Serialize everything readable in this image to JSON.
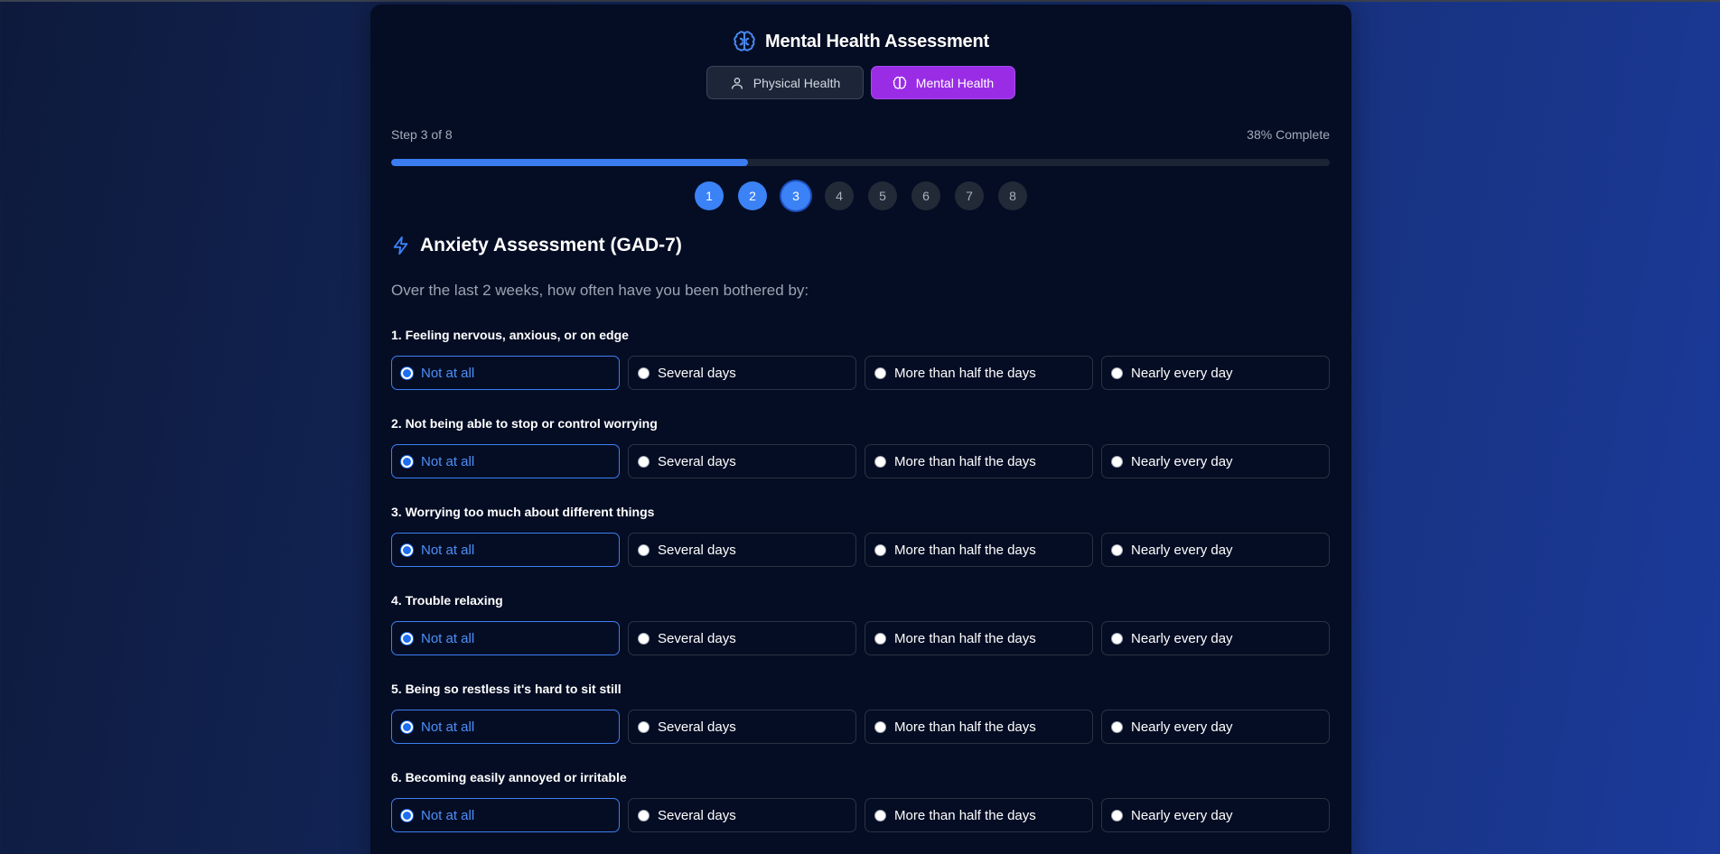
{
  "header": {
    "title": "Mental Health Assessment",
    "icon": "brain-icon",
    "accent": "#4a8bf5"
  },
  "tabs": [
    {
      "label": "Physical Health",
      "icon": "user-icon",
      "active": false
    },
    {
      "label": "Mental Health",
      "icon": "brain-icon",
      "active": true,
      "color": "#9a2ce6"
    }
  ],
  "progress": {
    "step_text": "Step 3 of 8",
    "percent_text": "38% Complete",
    "fraction": 0.38,
    "color": "#3b7cf0"
  },
  "steps": [
    {
      "label": "1",
      "state": "done"
    },
    {
      "label": "2",
      "state": "done"
    },
    {
      "label": "3",
      "state": "current"
    },
    {
      "label": "4",
      "state": "todo"
    },
    {
      "label": "5",
      "state": "todo"
    },
    {
      "label": "6",
      "state": "todo"
    },
    {
      "label": "7",
      "state": "todo"
    },
    {
      "label": "8",
      "state": "todo"
    }
  ],
  "section": {
    "title": "Anxiety Assessment (GAD-7)",
    "icon": "lightning-icon",
    "instructions": "Over the last 2 weeks, how often have you been bothered by:"
  },
  "options": [
    "Not at all",
    "Several days",
    "More than half the days",
    "Nearly every day"
  ],
  "questions": [
    {
      "label": "1. Feeling nervous, anxious, or on edge",
      "selected": "Not at all"
    },
    {
      "label": "2. Not being able to stop or control worrying",
      "selected": "Not at all"
    },
    {
      "label": "3. Worrying too much about different things",
      "selected": "Not at all"
    },
    {
      "label": "4. Trouble relaxing",
      "selected": "Not at all"
    },
    {
      "label": "5. Being so restless it's hard to sit still",
      "selected": "Not at all"
    },
    {
      "label": "6. Becoming easily annoyed or irritable",
      "selected": "Not at all"
    }
  ]
}
